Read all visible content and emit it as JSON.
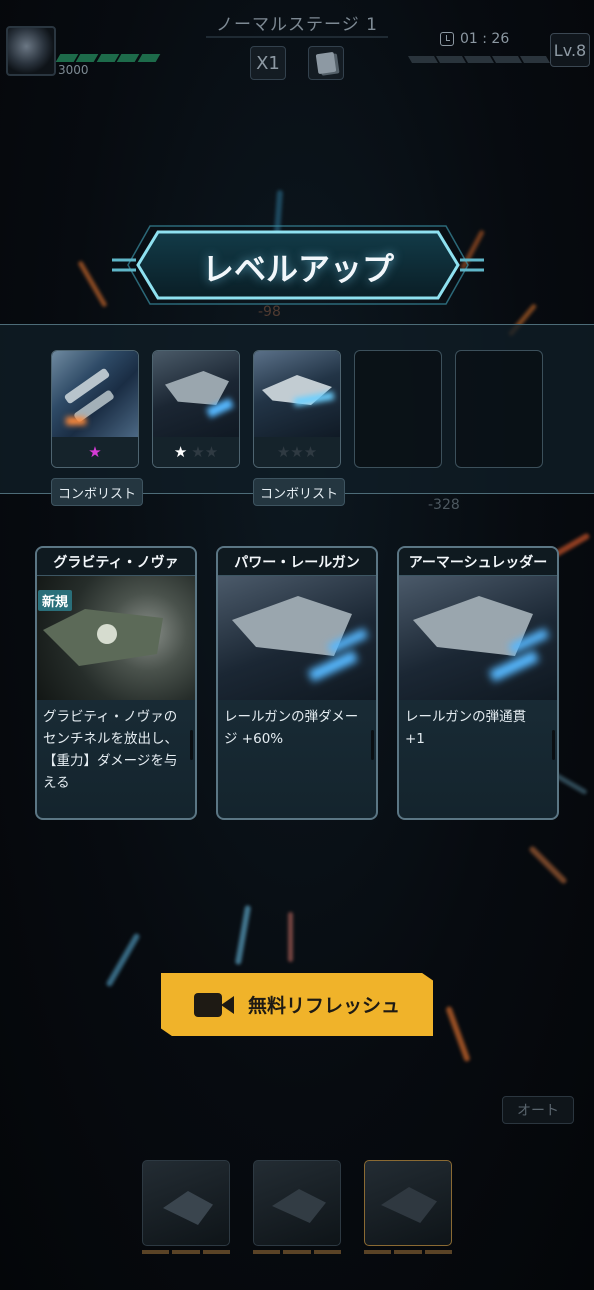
{
  "header": {
    "stage_title": "ノーマルステージ 1",
    "hp_value": "3000",
    "speed_label": "X1",
    "timer": "01 : 26",
    "level": "Lv.8"
  },
  "banner": {
    "title": "レベルアップ"
  },
  "floating_numbers": [
    "-98",
    "-328"
  ],
  "owned_weapons": [
    {
      "stars": "★",
      "star_color": "#d63bd6",
      "tag": "コンボリスト"
    },
    {
      "stars": "★★★",
      "star_color": "#ffffff",
      "tag": ""
    },
    {
      "stars": "★★★",
      "star_color": "#2f3a42",
      "tag": "コンボリスト"
    }
  ],
  "choices": [
    {
      "title": "グラビティ・ノヴァ",
      "badge": "新規",
      "description": "グラビティ・ノヴァのセンチネルを放出し、【重力】ダメージを与える"
    },
    {
      "title": "パワー・レールガン",
      "badge": "",
      "description": "レールガンの弾ダメージ +60%"
    },
    {
      "title": "アーマーシュレッダー",
      "badge": "",
      "description": "レールガンの弾通貫 +1"
    }
  ],
  "refresh_button": {
    "label": "無料リフレッシュ",
    "icon": "video-camera-icon",
    "color": "#f0b32a"
  },
  "auto_button": {
    "label": "オート"
  },
  "icons": [
    "clock-icon",
    "card-deck-icon",
    "video-camera-icon",
    "star-icon"
  ]
}
